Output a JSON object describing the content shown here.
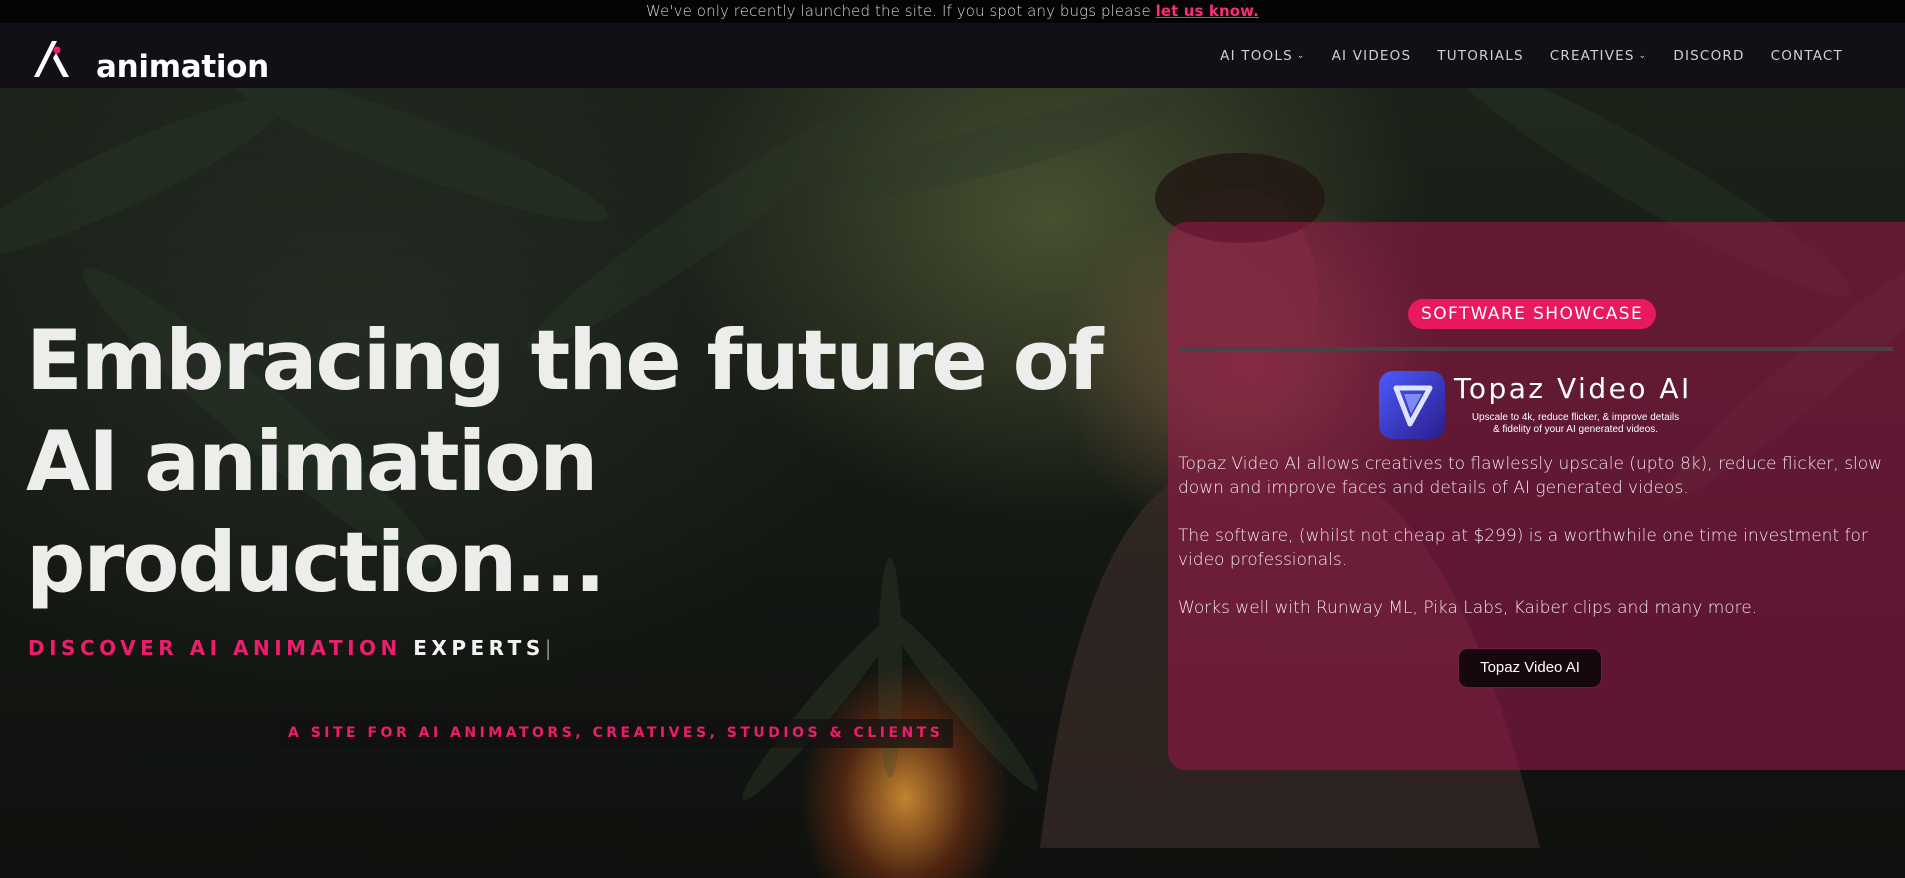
{
  "announcement": {
    "text": "We've only recently launched the site. If you spot any bugs please ",
    "link": "let us know."
  },
  "header": {
    "logo_text": "animation",
    "nav": [
      {
        "label": "AI TOOLS",
        "dropdown": true
      },
      {
        "label": "AI VIDEOS",
        "dropdown": false
      },
      {
        "label": "TUTORIALS",
        "dropdown": false
      },
      {
        "label": "CREATIVES",
        "dropdown": true
      },
      {
        "label": "DISCORD",
        "dropdown": false
      },
      {
        "label": "CONTACT",
        "dropdown": false
      }
    ]
  },
  "hero": {
    "headline_lines": [
      "Embracing the future of",
      "AI animation",
      "production..."
    ],
    "discover_pink": "DISCOVER AI ANIMATION",
    "discover_white": "EXPERTS",
    "tagline": "A SITE FOR AI ANIMATORS, CREATIVES, STUDIOS & CLIENTS"
  },
  "showcase": {
    "badge": "SOFTWARE SHOWCASE",
    "product_name": "Topaz Video AI",
    "product_sub_1": "Upscale to 4k, reduce flicker, & improve details",
    "product_sub_2": "& fidelity of your AI generated videos.",
    "paragraphs": [
      "Topaz Video AI allows creatives to flawlessly upscale (upto 8k), reduce flicker, slow down and improve faces and details of AI generated videos.",
      "The software, (whilst not cheap at $299) is a worthwhile one time investment for video professionals.",
      "Works well with Runway ML, Pika Labs, Kaiber clips and many more."
    ],
    "cta_label": "Topaz Video AI"
  },
  "colors": {
    "accent_pink": "#ee1d6b",
    "panel": "#a0184e",
    "header_bg": "#120f17"
  }
}
